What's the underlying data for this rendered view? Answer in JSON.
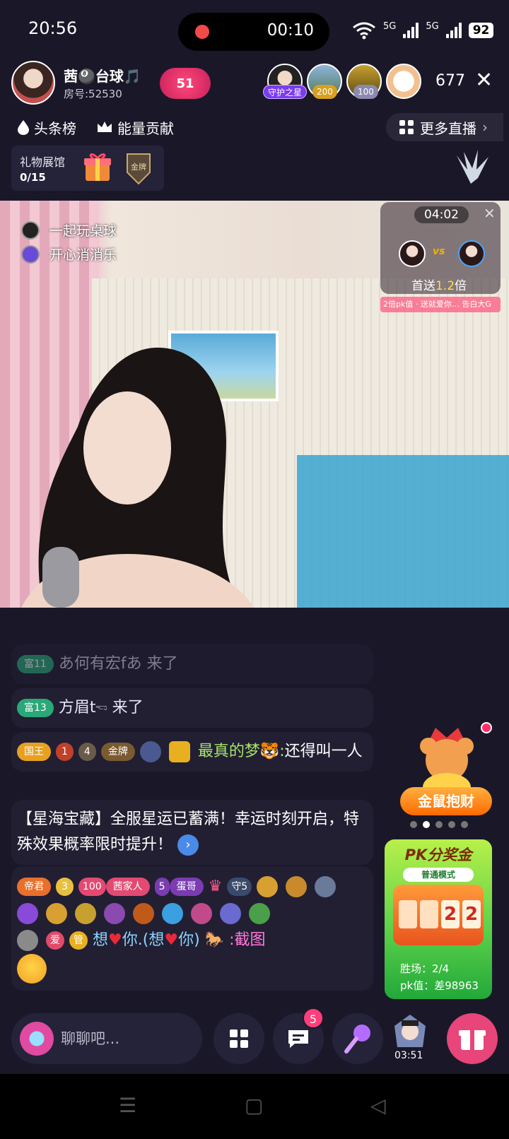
{
  "status_bar": {
    "time": "20:56",
    "rec_time": "00:10",
    "net1": "5G",
    "net2": "5G",
    "battery": "92"
  },
  "host": {
    "name": "茜🎱台球🎵",
    "room": "房号:52530",
    "likes": "51"
  },
  "viewers": {
    "badges": [
      "守护之星",
      "200",
      "100"
    ],
    "count": "677"
  },
  "nav_row": {
    "headline": "头条榜",
    "energy": "能量贡献",
    "more": "更多直播"
  },
  "gift_hall": {
    "label": "礼物展馆",
    "count": "0/15",
    "medal": "金牌"
  },
  "video_tags": {
    "tag1": "一起玩桌球",
    "tag2": "开心消消乐"
  },
  "pk": {
    "timer": "04:02",
    "vs": "vs",
    "first_prefix": "首送",
    "first_value": "1.2",
    "first_suffix": "倍",
    "ticker": "2倍pk值 · 送就爱你… 告白大G"
  },
  "chat": [
    {
      "level": "富11",
      "text": "あ何有宏fあ 来了"
    },
    {
      "level": "富13",
      "text": "方眉t🖘 来了"
    },
    {
      "badges": [
        "国王",
        "1",
        "4",
        "金牌"
      ],
      "user": "最真的梦🐯",
      "colon": ":",
      "text": "还得叫一人"
    },
    {
      "system": "【星海宝藏】全服星运已蓄满！幸运时刻开启，特殊效果概率限时提升！"
    },
    {
      "badges": [
        "帝君",
        "3",
        "100",
        "茜家人",
        "5",
        "蛋哥",
        "守5"
      ],
      "user_parts": [
        "爱",
        "管",
        "想",
        "你.(想",
        "你)"
      ],
      "colon": ":",
      "text": "截图"
    }
  ],
  "side": {
    "jinshu": "金鼠抱财",
    "pk_prize_title": "PK分奖金",
    "pk_prize_mode": "普通模式",
    "digits": [
      "",
      "",
      "2",
      "2"
    ],
    "rounds": "胜场：2/4",
    "pk_value": "pk值：差98963"
  },
  "bottom": {
    "placeholder": "聊聊吧...",
    "msg_count": "5",
    "guard_timer": "03:51"
  },
  "colors": {
    "bg": "#1a1828",
    "accent": "#e8457a",
    "card": "#221f33"
  }
}
